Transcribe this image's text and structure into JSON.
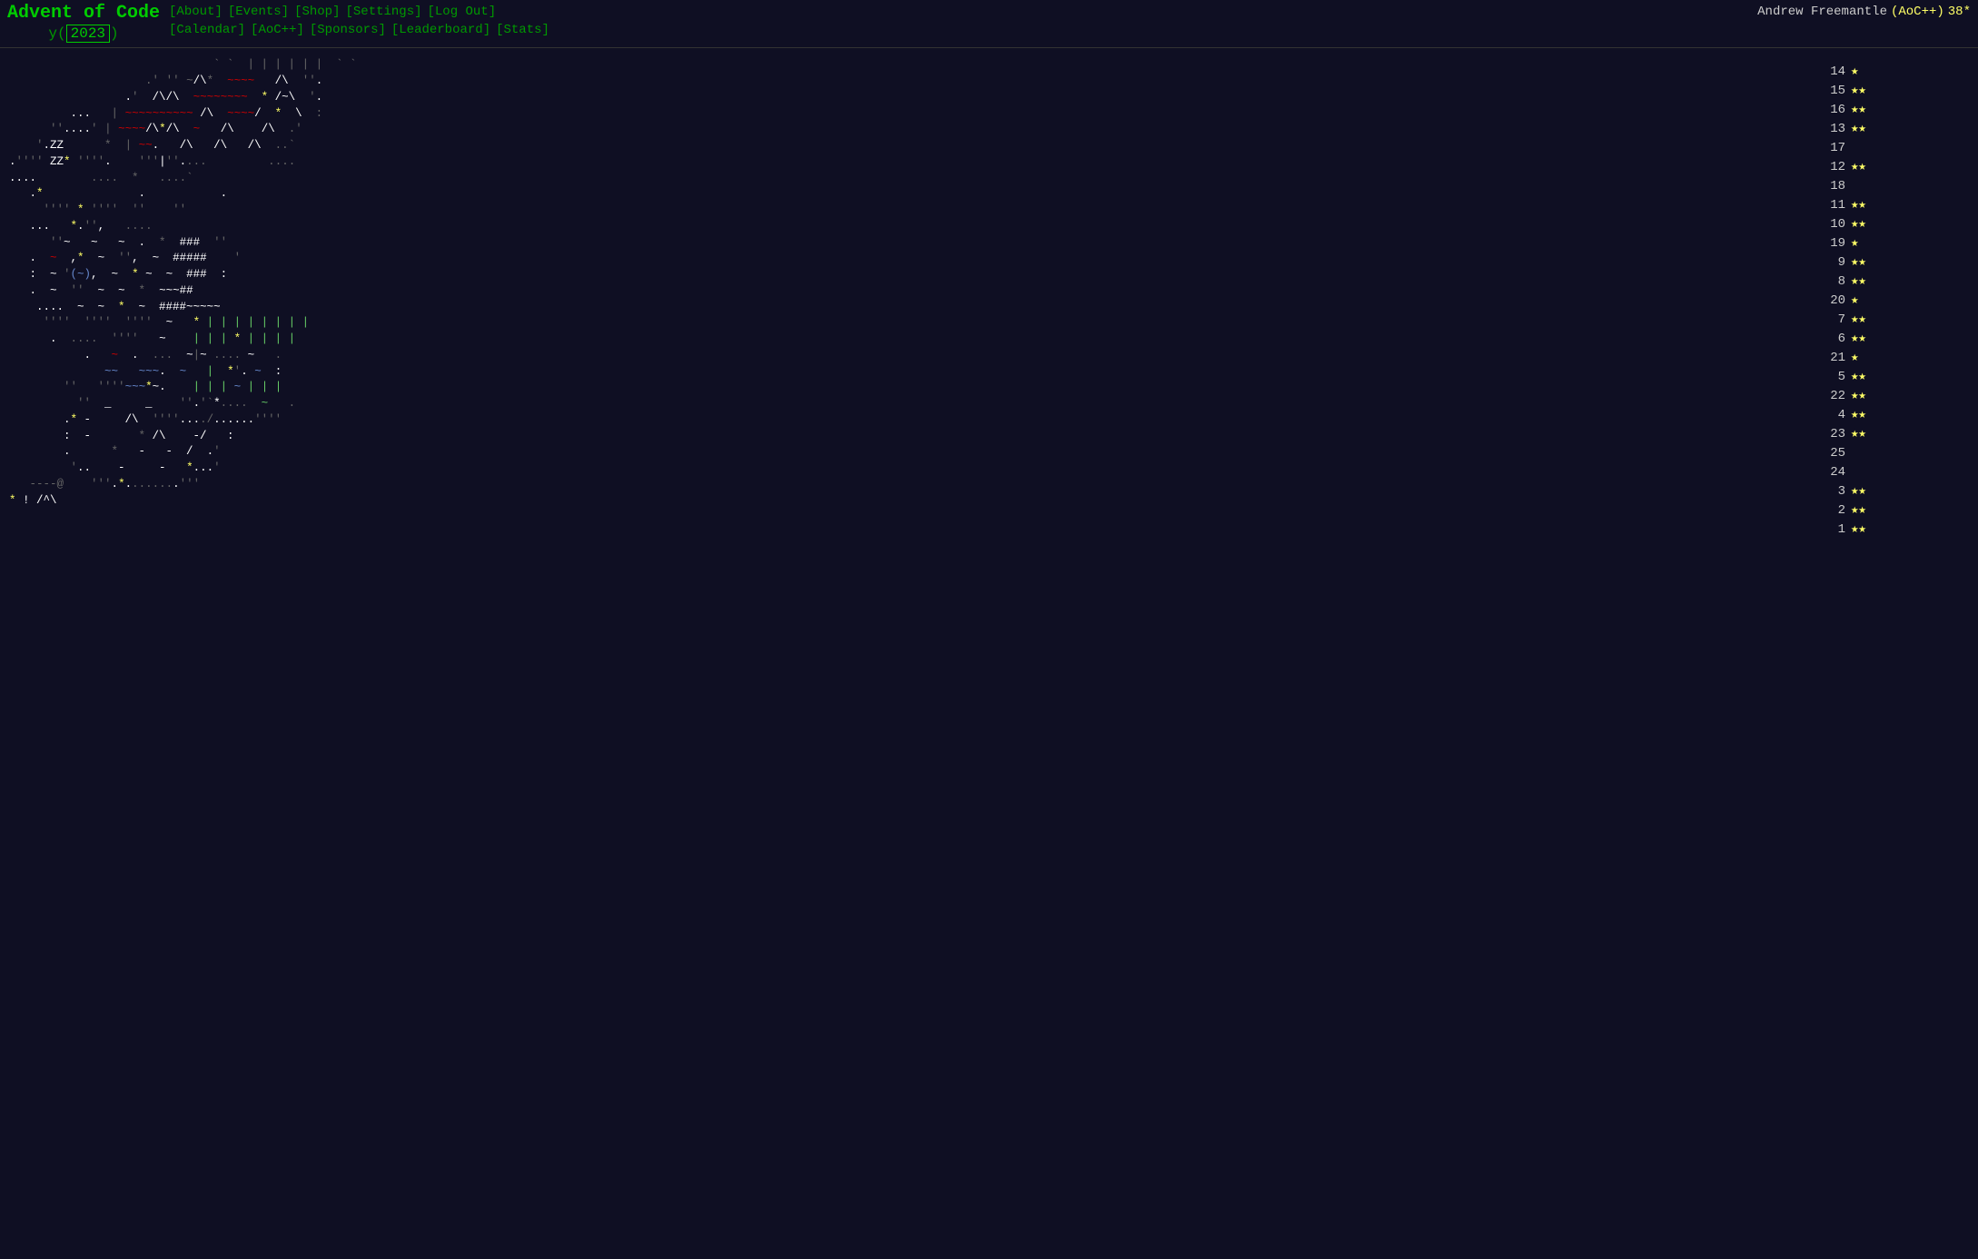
{
  "header": {
    "title": "Advent of Code",
    "year": "2023",
    "nav_row1": [
      {
        "label": "[About]",
        "href": "#"
      },
      {
        "label": "[Events]",
        "href": "#"
      },
      {
        "label": "[Shop]",
        "href": "#"
      },
      {
        "label": "[Settings]",
        "href": "#"
      },
      {
        "label": "[Log Out]",
        "href": "#"
      }
    ],
    "nav_row2": [
      {
        "label": "[Calendar]",
        "href": "#"
      },
      {
        "label": "[AoC++]",
        "href": "#"
      },
      {
        "label": "[Sponsors]",
        "href": "#"
      },
      {
        "label": "[Leaderboard]",
        "href": "#"
      },
      {
        "label": "[Stats]",
        "href": "#"
      }
    ],
    "user": {
      "name": "Andrew Freemantle",
      "badge": "(AoC++)",
      "stars": "38*"
    }
  },
  "days": [
    {
      "day": "14",
      "stars": "★"
    },
    {
      "day": "15",
      "stars": "★★"
    },
    {
      "day": "16",
      "stars": "★★"
    },
    {
      "day": "13",
      "stars": "★★"
    },
    {
      "day": "17",
      "stars": ""
    },
    {
      "day": "12",
      "stars": "★★"
    },
    {
      "day": "18",
      "stars": ""
    },
    {
      "day": "11",
      "stars": "★★"
    },
    {
      "day": "10",
      "stars": "★★"
    },
    {
      "day": "19",
      "stars": "★"
    },
    {
      "day": "9",
      "stars": "★★"
    },
    {
      "day": "8",
      "stars": "★★"
    },
    {
      "day": "20",
      "stars": "★"
    },
    {
      "day": "7",
      "stars": "★★"
    },
    {
      "day": "6",
      "stars": "★★"
    },
    {
      "day": "21",
      "stars": "★"
    },
    {
      "day": "5",
      "stars": "★★"
    },
    {
      "day": "22",
      "stars": "★★"
    },
    {
      "day": "4",
      "stars": "★★"
    },
    {
      "day": "23",
      "stars": "★★"
    },
    {
      "day": "25",
      "stars": ""
    },
    {
      "day": "24",
      "stars": ""
    },
    {
      "day": "3",
      "stars": "★★"
    },
    {
      "day": "2",
      "stars": "★★"
    },
    {
      "day": "1",
      "stars": "★★"
    }
  ]
}
